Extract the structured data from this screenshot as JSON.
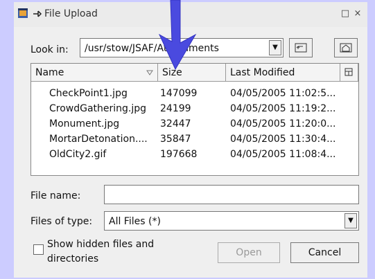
{
  "window": {
    "title": "File Upload"
  },
  "look_in": {
    "label": "Look in:",
    "path": "/usr/stow/JSAF/Attachments"
  },
  "columns": [
    "Name",
    "Size",
    "Last Modified"
  ],
  "files": [
    {
      "name": "CheckPoint1.jpg",
      "size": "147099",
      "modified": "04/05/2005 11:02:5..."
    },
    {
      "name": "CrowdGathering.jpg",
      "size": "24199",
      "modified": "04/05/2005 11:19:2..."
    },
    {
      "name": "Monument.jpg",
      "size": "32447",
      "modified": "04/05/2005 11:20:0..."
    },
    {
      "name": "MortarDetonation....",
      "size": "35847",
      "modified": "04/05/2005 11:30:4..."
    },
    {
      "name": "OldCity2.gif",
      "size": "197668",
      "modified": "04/05/2005 11:08:4..."
    }
  ],
  "file_name": {
    "label": "File name:",
    "value": ""
  },
  "files_of_type": {
    "label": "Files of type:",
    "value": "All Files (*)"
  },
  "show_hidden": {
    "label_line1": "Show hidden files and",
    "label_line2": "directories",
    "checked": false
  },
  "buttons": {
    "open": "Open",
    "cancel": "Cancel"
  },
  "colors": {
    "background": "#ccccff",
    "annotation_arrow": "#4a4adf"
  }
}
